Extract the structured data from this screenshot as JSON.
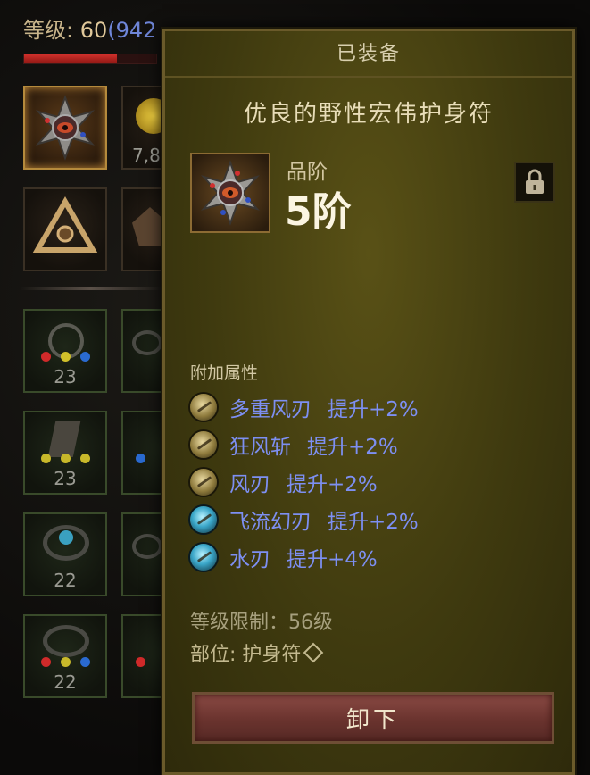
{
  "player": {
    "level_label": "等级: ",
    "level": "60",
    "exp_points": "(942",
    "hp_fill": 0.7
  },
  "inventory": {
    "badges": [
      "7,8",
      "23",
      "23",
      "22",
      "22"
    ]
  },
  "tooltip": {
    "header": "已装备",
    "item_name": "优良的野性宏伟护身符",
    "grade_label": "品阶",
    "grade_value": "5阶",
    "attributes_heading": "附加属性",
    "attributes": [
      {
        "name": "多重风刃",
        "effect": "提升+2%",
        "icon": "wind-blade-icon"
      },
      {
        "name": "狂风斩",
        "effect": "提升+2%",
        "icon": "gale-slash-icon"
      },
      {
        "name": "风刃",
        "effect": "提升+2%",
        "icon": "wind-edge-icon"
      },
      {
        "name": "飞流幻刃",
        "effect": "提升+2%",
        "icon": "flowing-blade-icon"
      },
      {
        "name": "水刃",
        "effect": "提升+4%",
        "icon": "water-blade-icon"
      }
    ],
    "level_requirement": "等级限制：56级",
    "slot_line": "部位: 护身符",
    "unequip_label": "卸下"
  },
  "colors": {
    "panel_bg": "#4a4412",
    "attribute_text": "#7d8ff2",
    "button_bg": "#6a332e",
    "exp_text": "#6f86d8"
  }
}
